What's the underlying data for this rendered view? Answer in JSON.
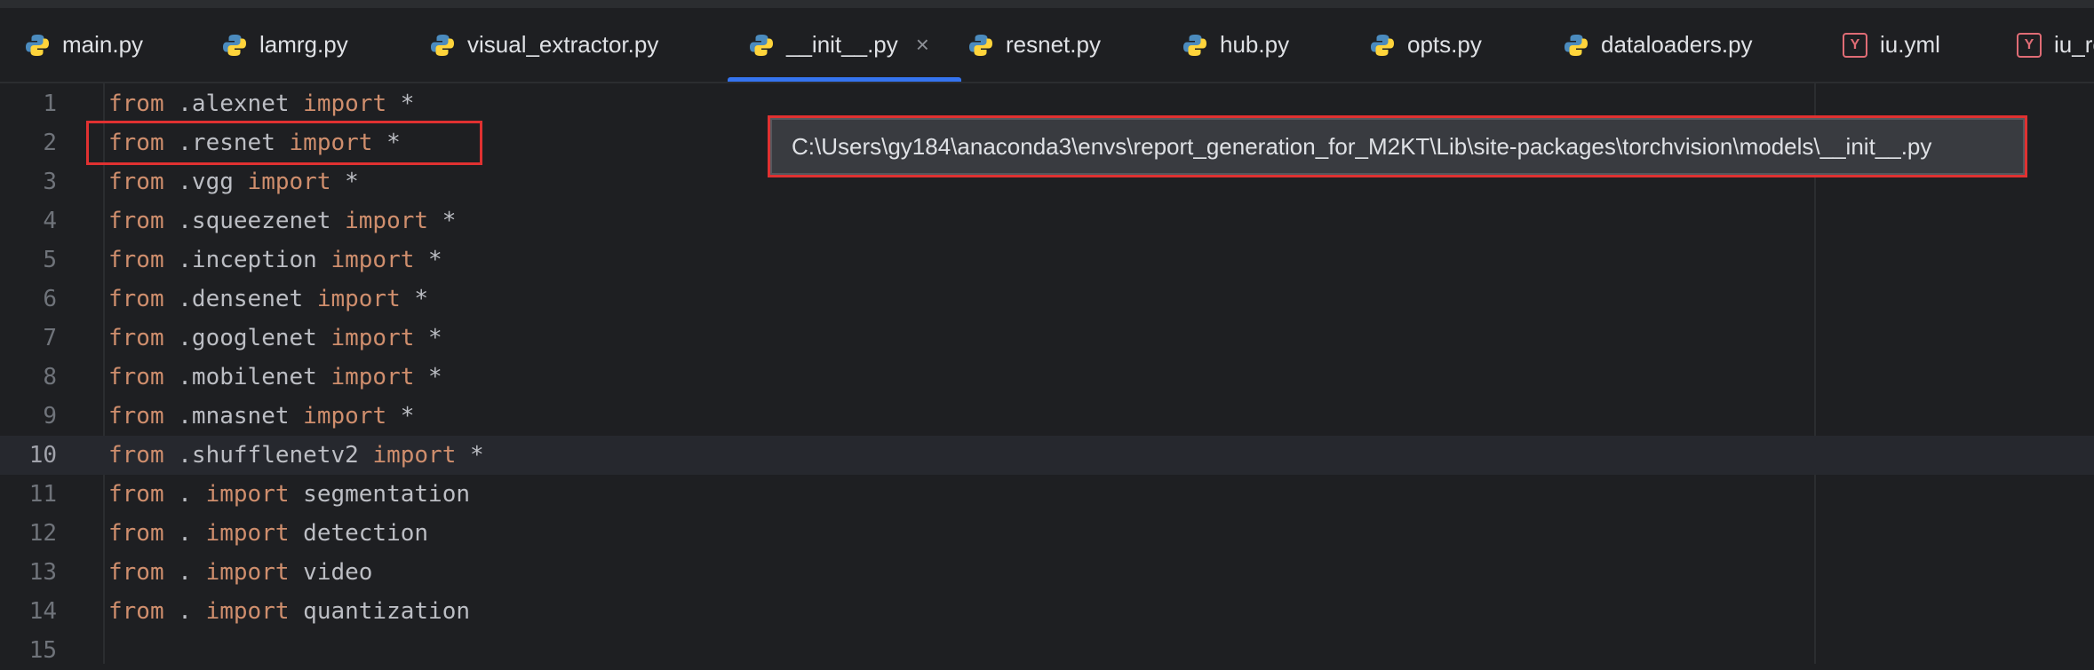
{
  "tabs": [
    {
      "label": "main.py",
      "icon": "python-icon"
    },
    {
      "label": "lamrg.py",
      "icon": "python-icon"
    },
    {
      "label": "visual_extractor.py",
      "icon": "python-icon"
    },
    {
      "label": "__init__.py",
      "icon": "python-icon",
      "active": true,
      "close": "×"
    },
    {
      "label": "resnet.py",
      "icon": "python-icon"
    },
    {
      "label": "hub.py",
      "icon": "python-icon"
    },
    {
      "label": "opts.py",
      "icon": "python-icon"
    },
    {
      "label": "dataloaders.py",
      "icon": "python-icon"
    },
    {
      "label": "iu.yml",
      "icon": "yaml-icon"
    },
    {
      "label": "iu_re",
      "icon": "yaml-icon"
    }
  ],
  "tooltip": {
    "path": "C:\\Users\\gy184\\anaconda3\\envs\\report_generation_for_M2KT\\Lib\\site-packages\\torchvision\\models\\__init__.py"
  },
  "editor": {
    "current_line": 10,
    "lines": [
      {
        "num": "1",
        "kw1": "from",
        "mod": " .alexnet ",
        "kw2": "import",
        "rest": " *"
      },
      {
        "num": "2",
        "kw1": "from",
        "mod": " .resnet ",
        "kw2": "import",
        "rest": " *"
      },
      {
        "num": "3",
        "kw1": "from",
        "mod": " .vgg ",
        "kw2": "import",
        "rest": " *"
      },
      {
        "num": "4",
        "kw1": "from",
        "mod": " .squeezenet ",
        "kw2": "import",
        "rest": " *"
      },
      {
        "num": "5",
        "kw1": "from",
        "mod": " .inception ",
        "kw2": "import",
        "rest": " *"
      },
      {
        "num": "6",
        "kw1": "from",
        "mod": " .densenet ",
        "kw2": "import",
        "rest": " *"
      },
      {
        "num": "7",
        "kw1": "from",
        "mod": " .googlenet ",
        "kw2": "import",
        "rest": " *"
      },
      {
        "num": "8",
        "kw1": "from",
        "mod": " .mobilenet ",
        "kw2": "import",
        "rest": " *"
      },
      {
        "num": "9",
        "kw1": "from",
        "mod": " .mnasnet ",
        "kw2": "import",
        "rest": " *"
      },
      {
        "num": "10",
        "kw1": "from",
        "mod": " .shufflenetv2 ",
        "kw2": "import",
        "rest": " *"
      },
      {
        "num": "11",
        "kw1": "from",
        "mod": " . ",
        "kw2": "import",
        "rest": " segmentation"
      },
      {
        "num": "12",
        "kw1": "from",
        "mod": " . ",
        "kw2": "import",
        "rest": " detection"
      },
      {
        "num": "13",
        "kw1": "from",
        "mod": " . ",
        "kw2": "import",
        "rest": " video"
      },
      {
        "num": "14",
        "kw1": "from",
        "mod": " . ",
        "kw2": "import",
        "rest": " quantization"
      },
      {
        "num": "15",
        "kw1": "",
        "mod": "",
        "kw2": "",
        "rest": ""
      }
    ]
  },
  "colors": {
    "background": "#1e1f22",
    "keyword": "#cf8e6d",
    "text": "#bcbec4",
    "highlight_box": "#e03131",
    "active_tab_underline": "#3574f0"
  }
}
